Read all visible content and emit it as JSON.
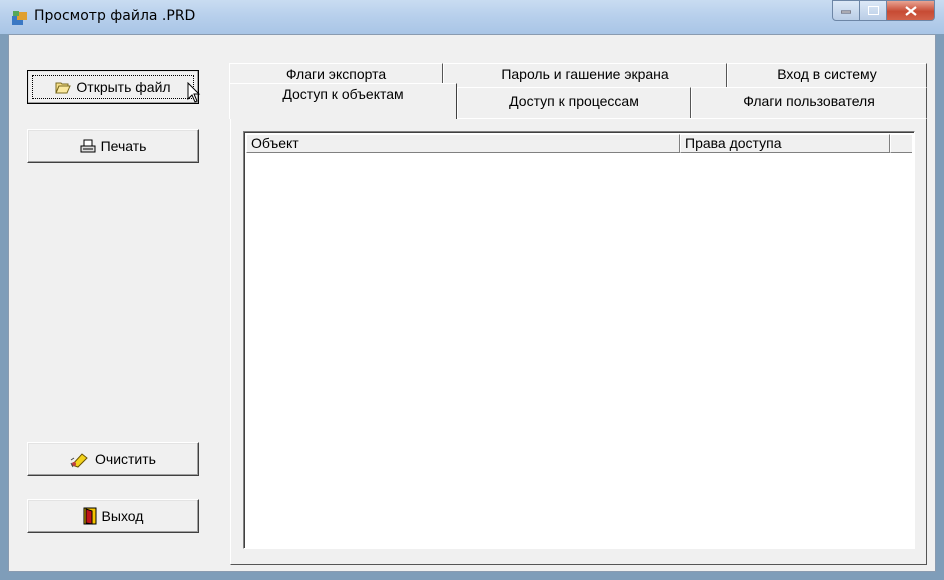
{
  "window": {
    "title": "Просмотр файла .PRD"
  },
  "buttons": {
    "open": "Открыть файл",
    "print": "Печать",
    "clear": "Очистить",
    "exit": "Выход"
  },
  "tabs": {
    "back_row": [
      "Флаги экспорта",
      "Пароль и гашение экрана",
      "Вход в систему"
    ],
    "front_row": [
      "Доступ к объектам",
      "Доступ к процессам",
      "Флаги пользователя"
    ],
    "active": "Доступ к объектам"
  },
  "table": {
    "columns": [
      "Объект",
      "Права доступа"
    ],
    "rows": []
  },
  "icons": [
    "app-icon",
    "folder-open-icon",
    "printer-icon",
    "eraser-icon",
    "exit-door-icon",
    "cursor-icon"
  ]
}
